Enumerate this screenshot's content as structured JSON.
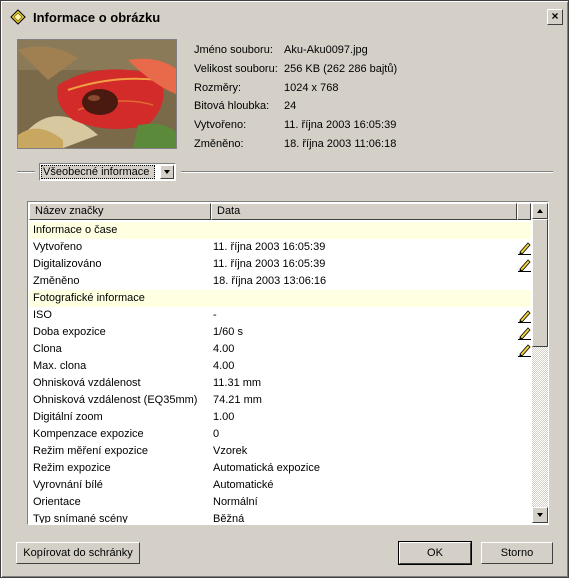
{
  "window": {
    "title": "Informace o obrázku",
    "close_label": "×"
  },
  "file_info": [
    {
      "label": "Jméno souboru:",
      "value": "Aku-Aku0097.jpg"
    },
    {
      "label": "Velikost souboru:",
      "value": "256 KB (262 286 bajtů)"
    },
    {
      "label": "Rozměry:",
      "value": "1024 x 768"
    },
    {
      "label": "Bitová hloubka:",
      "value": "24"
    },
    {
      "label": "Vytvořeno:",
      "value": "11. října 2003 16:05:39"
    },
    {
      "label": "Změněno:",
      "value": "18. října 2003 11:06:18"
    }
  ],
  "category_select": {
    "selected": "Všeobecné informace"
  },
  "table": {
    "headers": [
      "Název značky",
      "Data"
    ],
    "rows": [
      {
        "name": "Informace o čase",
        "section": true
      },
      {
        "name": "Vytvořeno",
        "value": "11. října 2003 16:05:39",
        "editable": true
      },
      {
        "name": "Digitalizováno",
        "value": "11. října 2003 16:05:39",
        "editable": true
      },
      {
        "name": "Změněno",
        "value": "18. října 2003 13:06:16"
      },
      {
        "name": "Fotografické informace",
        "section": true
      },
      {
        "name": "ISO",
        "value": "-",
        "editable": true
      },
      {
        "name": "Doba expozice",
        "value": "1/60 s",
        "editable": true
      },
      {
        "name": "Clona",
        "value": "4.00",
        "editable": true
      },
      {
        "name": "Max. clona",
        "value": "4.00"
      },
      {
        "name": "Ohnisková vzdálenost",
        "value": "11.31 mm"
      },
      {
        "name": "Ohnisková vzdálenost (EQ35mm)",
        "value": "74.21 mm"
      },
      {
        "name": "Digitální zoom",
        "value": "1.00"
      },
      {
        "name": "Kompenzace expozice",
        "value": "0"
      },
      {
        "name": "Režim měření expozice",
        "value": "Vzorek"
      },
      {
        "name": "Režim expozice",
        "value": "Automatická expozice"
      },
      {
        "name": "Vyrovnání bílé",
        "value": "Automatické"
      },
      {
        "name": "Orientace",
        "value": "Normální"
      },
      {
        "name": "Typ snímané scény",
        "value": "Běžná"
      }
    ]
  },
  "buttons": {
    "copy": "Kopírovat do schránky",
    "ok": "OK",
    "cancel": "Storno"
  },
  "colors": {
    "section_bg": "#ffffe1",
    "face": "#d4d0c8"
  }
}
